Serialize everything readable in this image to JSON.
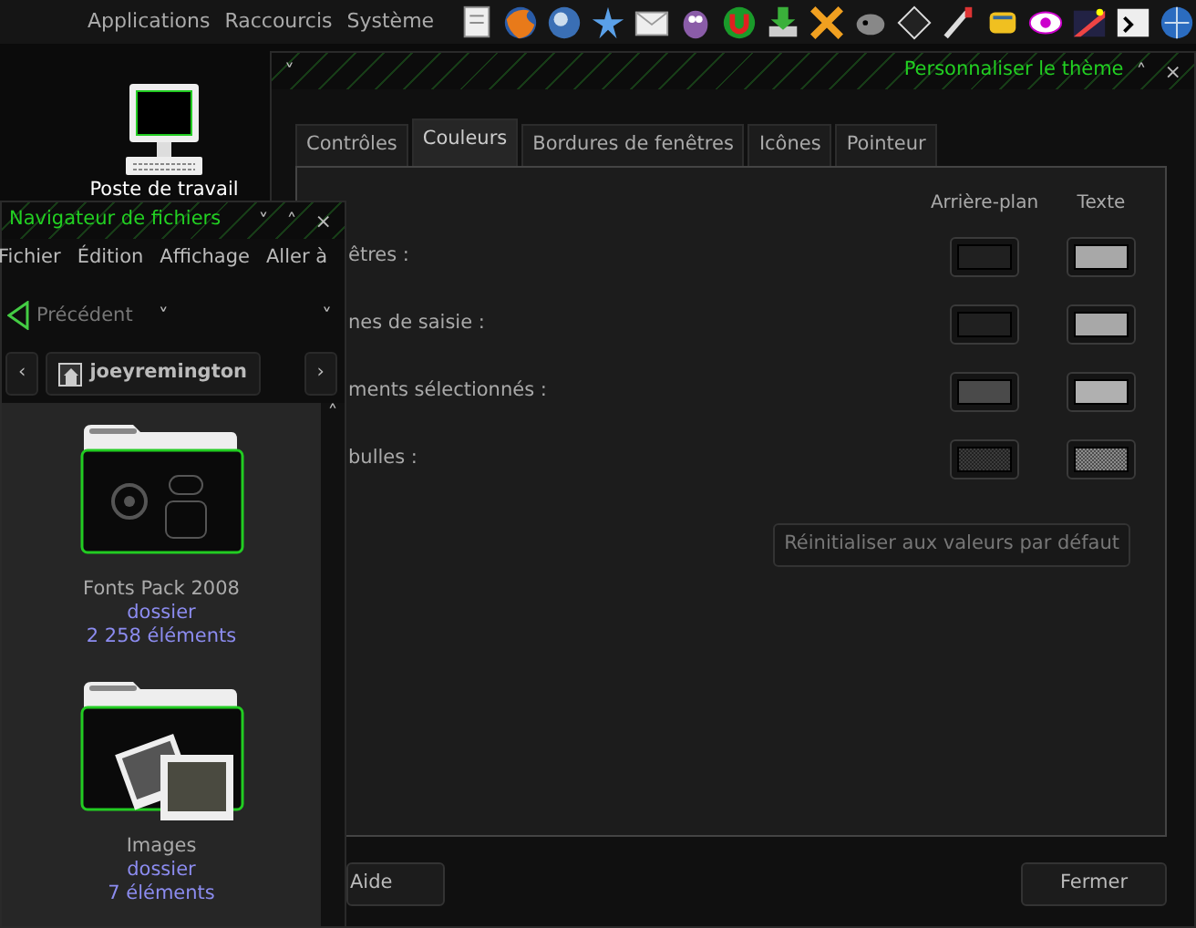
{
  "top_panel": {
    "menus": [
      "Applications",
      "Raccourcis",
      "Système"
    ]
  },
  "desktop_icons": [
    {
      "label": "Poste de travail"
    }
  ],
  "theme_dialog": {
    "menu_button": "˅",
    "title": "Personnaliser le thème",
    "window_buttons": [
      "˄",
      "×"
    ],
    "tabs": [
      {
        "label": "Contrôles",
        "selected": false
      },
      {
        "label": "Couleurs",
        "selected": true
      },
      {
        "label": "Bordures de fenêtres",
        "selected": false
      },
      {
        "label": "Icônes",
        "selected": false
      },
      {
        "label": "Pointeur",
        "selected": false
      }
    ],
    "column_headers": [
      "Arrière-plan",
      "Texte"
    ],
    "rows": [
      {
        "label": "êtres :",
        "swatches": [
          {
            "color": "#202020",
            "dithered": false
          },
          {
            "color": "#a8a8a8",
            "dithered": false
          }
        ]
      },
      {
        "label": "nes de saisie :",
        "swatches": [
          {
            "color": "#202020",
            "dithered": false
          },
          {
            "color": "#a8a8a8",
            "dithered": false
          }
        ]
      },
      {
        "label": "ments sélectionnés :",
        "swatches": [
          {
            "color": "#4a4a4a",
            "dithered": false
          },
          {
            "color": "#b0b0b0",
            "dithered": false
          }
        ]
      },
      {
        "label": "bulles :",
        "swatches": [
          {
            "color": "#3c3c3c",
            "dithered": true
          },
          {
            "color": "#8c8c8c",
            "dithered": true
          }
        ]
      }
    ],
    "reset_button": "Réinitialiser aux valeurs par défaut",
    "help_button": "Aide",
    "close_button": "Fermer"
  },
  "file_manager": {
    "title": "Navigateur de fichiers",
    "window_buttons": [
      "˅",
      "˄",
      "×"
    ],
    "menus": [
      "Fichier",
      "Édition",
      "Affichage",
      "Aller à"
    ],
    "back_button": "Précédent",
    "back_dropdown": "˅",
    "location_dropdown": "˅",
    "path_left": "‹",
    "path": "joeyremington",
    "path_right": "›",
    "scroll_up": "˄",
    "items": [
      {
        "name": "Fonts Pack 2008",
        "type": "dossier",
        "count": "2 258 éléments",
        "kind": "fonts"
      },
      {
        "name": "Images",
        "type": "dossier",
        "count": "7 éléments",
        "kind": "images"
      }
    ]
  }
}
